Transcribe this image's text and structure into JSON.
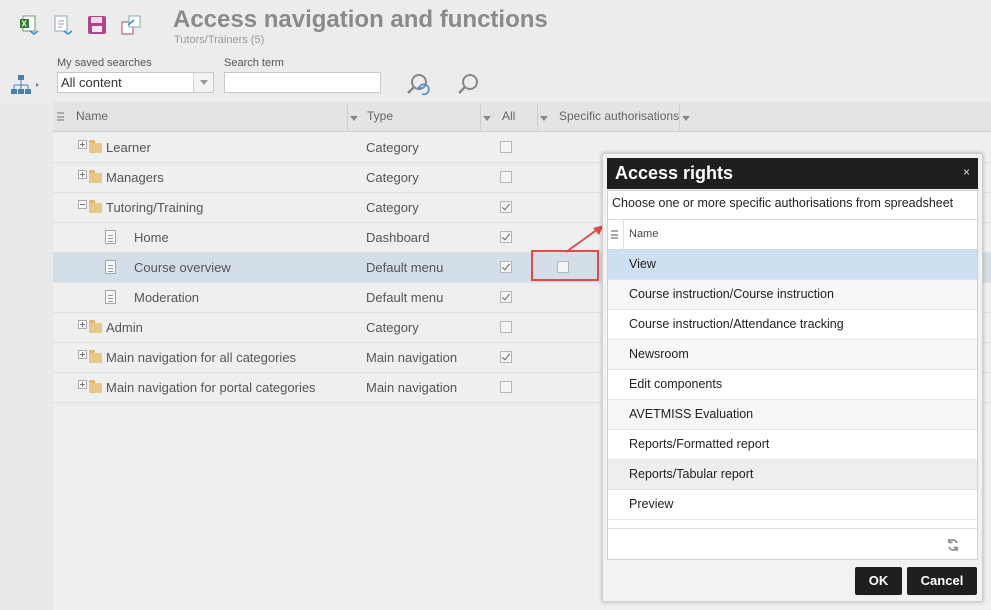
{
  "header": {
    "title": "Access navigation and functions",
    "subtitle": "Tutors/Trainers (5)"
  },
  "toolbar": {
    "icons": [
      "excel-export-icon",
      "export-icon",
      "save-icon",
      "transfer-icon"
    ]
  },
  "search": {
    "saved_label": "My saved searches",
    "saved_value": "All content",
    "term_label": "Search term",
    "term_value": ""
  },
  "grid": {
    "columns": {
      "name": "Name",
      "type": "Type",
      "all": "All",
      "specific": "Specific authorisations"
    },
    "rows": [
      {
        "name": "Learner",
        "type": "Category",
        "all": false,
        "level": 0,
        "kind": "folder",
        "expander": "plus"
      },
      {
        "name": "Managers",
        "type": "Category",
        "all": false,
        "level": 0,
        "kind": "folder",
        "expander": "plus"
      },
      {
        "name": "Tutoring/Training",
        "type": "Category",
        "all": true,
        "level": 0,
        "kind": "folder",
        "expander": "minus"
      },
      {
        "name": "Home",
        "type": "Dashboard",
        "all": true,
        "level": 1,
        "kind": "doc"
      },
      {
        "name": "Course overview",
        "type": "Default menu",
        "all": true,
        "level": 1,
        "kind": "doc",
        "selected": true,
        "specific": false
      },
      {
        "name": "Moderation",
        "type": "Default menu",
        "all": true,
        "level": 1,
        "kind": "doc"
      },
      {
        "name": "Admin",
        "type": "Category",
        "all": false,
        "level": 0,
        "kind": "folder",
        "expander": "plus"
      },
      {
        "name": "Main navigation for all categories",
        "type": "Main navigation",
        "all": true,
        "level": 0,
        "kind": "folder",
        "expander": "plus"
      },
      {
        "name": "Main navigation for portal categories",
        "type": "Main navigation",
        "all": false,
        "level": 0,
        "kind": "folder",
        "expander": "plus"
      }
    ]
  },
  "dialog": {
    "title": "Access rights",
    "close": "×",
    "instruction": "Choose one or more specific authorisations from spreadsheet",
    "column": "Name",
    "items": [
      "View",
      "Course instruction/Course instruction",
      "Course instruction/Attendance tracking",
      "Newsroom",
      "Edit components",
      "AVETMISS Evaluation",
      "Reports/Formatted report",
      "Reports/Tabular report",
      "Preview"
    ],
    "highlighted_index": 0,
    "hover_index": 7,
    "ok": "OK",
    "cancel": "Cancel"
  },
  "colors": {
    "selected_row": "#d3dee8",
    "dialog_highlight": "#cde0f2",
    "annotation_red": "#e34b4b",
    "button_dark": "#1f1f1f"
  }
}
